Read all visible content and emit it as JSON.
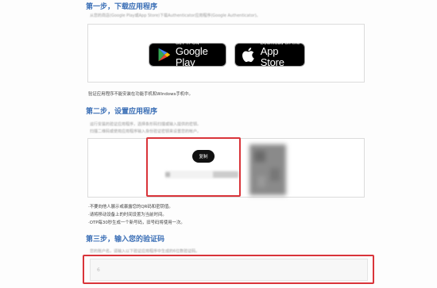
{
  "step1": {
    "title": "第一步，下载应用程序",
    "subtitle": "从您的商店(Google Play或App Store)下载Authenticator应用程序(Google Authenticator)。",
    "google_play": {
      "small": "GET IT ON",
      "big": "Google Play"
    },
    "app_store": {
      "small": "Download on the",
      "big": "App Store"
    },
    "note": "验证应用程序不能安装在功能手机和Windows手机中。"
  },
  "step2": {
    "title": "第二步，设置应用程序",
    "sub_line1": "运行安装的验证应用程序，选择条形码扫描或输入提供的密钥。",
    "sub_line2": "扫描二维码或使用应用程序输入身份验证密钥来设置您的帐户。",
    "copy_label": "复制",
    "notes": [
      "·不要向他人展示或暴露您的QR码和密钥值。",
      "·请将移动设备上的时间设置为当前时间。",
      "·OTP每30秒生成一个新号码，旧号码将使用一次。"
    ]
  },
  "step3": {
    "title": "第三步，输入您的验证码",
    "subtitle": "您的账户名，请输入以下验证应用程序中生成的6位数验证码。",
    "input_placeholder": "6"
  },
  "colors": {
    "accent": "#3b6fb6",
    "highlight": "#d9343a"
  }
}
